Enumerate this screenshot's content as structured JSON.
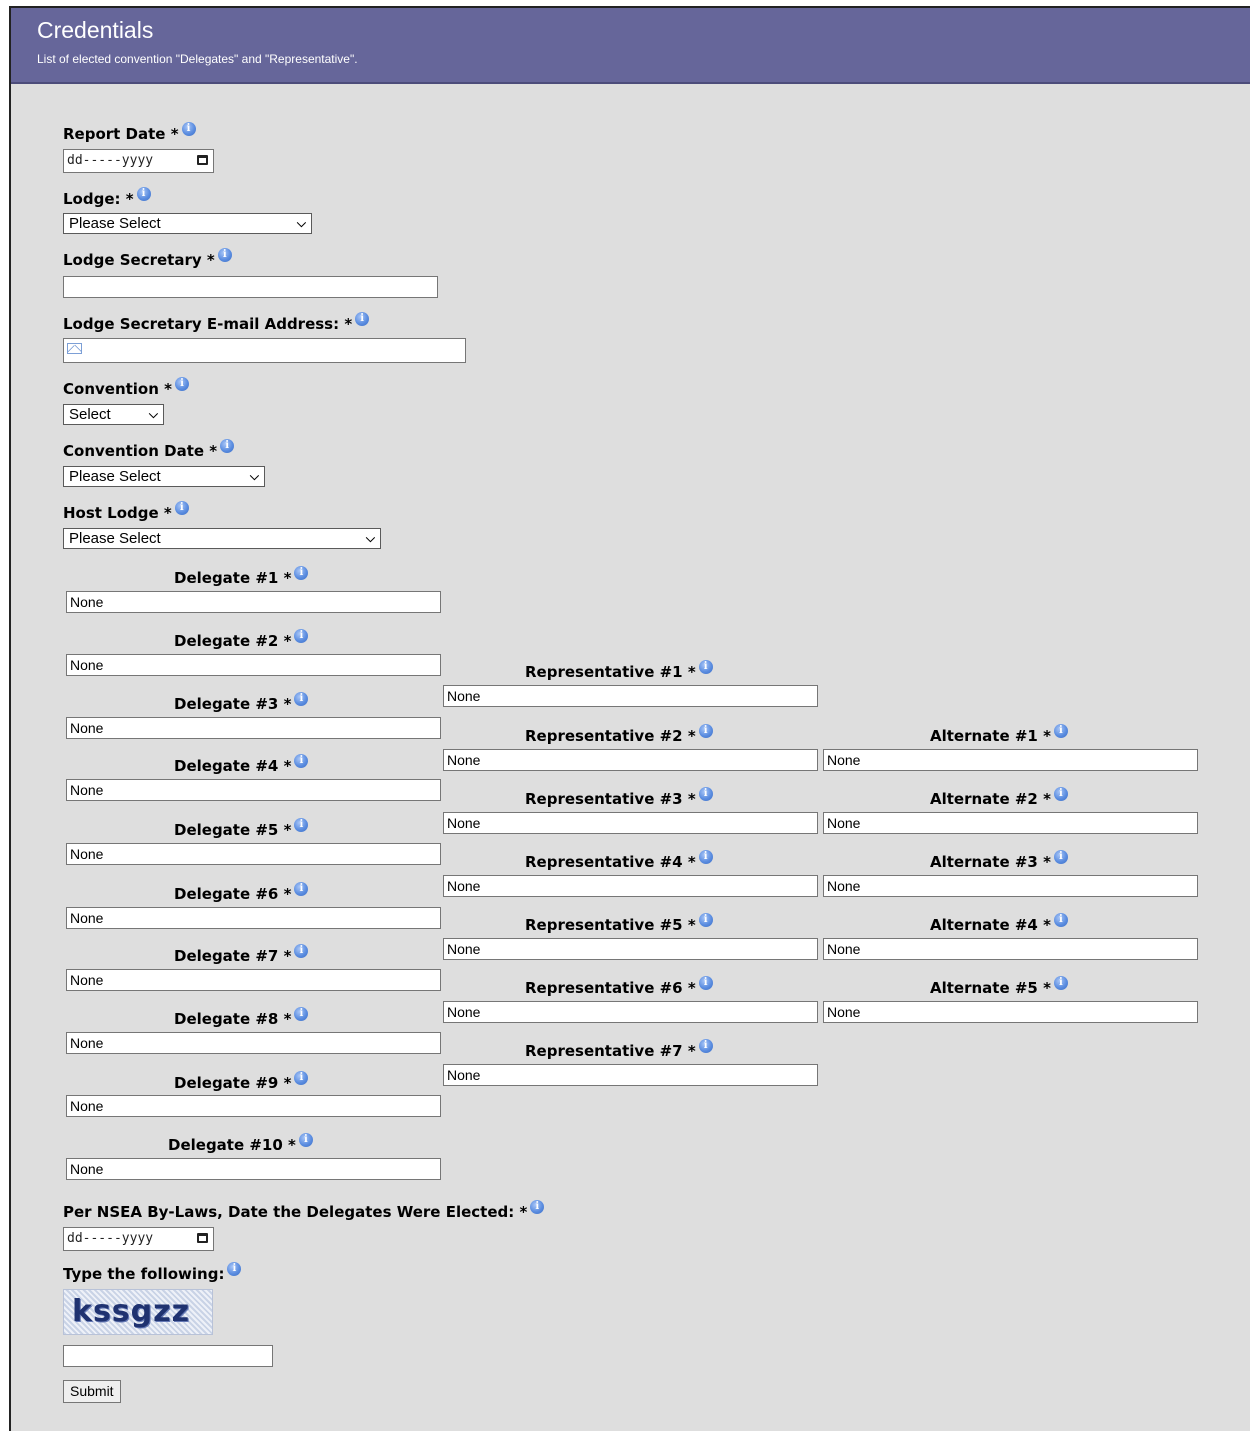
{
  "header": {
    "title": "Credentials",
    "subtitle": "List of elected convention \"Delegates\" and \"Representative\"."
  },
  "form": {
    "report_date": {
      "label": "Report Date *",
      "placeholder": "dd-----yyyy"
    },
    "lodge": {
      "label": "Lodge: *",
      "value": "Please Select"
    },
    "lodge_secretary": {
      "label": "Lodge Secretary *",
      "value": ""
    },
    "secretary_email": {
      "label": "Lodge Secretary E-mail Address: *",
      "value": ""
    },
    "convention": {
      "label": "Convention *",
      "value": "Select"
    },
    "convention_date": {
      "label": "Convention Date *",
      "value": "Please Select"
    },
    "host_lodge": {
      "label": "Host Lodge *",
      "value": "Please Select"
    },
    "delegates": [
      {
        "label": "Delegate #1 *",
        "value": "None"
      },
      {
        "label": "Delegate #2 *",
        "value": "None"
      },
      {
        "label": "Delegate #3 *",
        "value": "None"
      },
      {
        "label": "Delegate #4 *",
        "value": "None"
      },
      {
        "label": "Delegate #5 *",
        "value": "None"
      },
      {
        "label": "Delegate #6 *",
        "value": "None"
      },
      {
        "label": "Delegate #7 *",
        "value": "None"
      },
      {
        "label": "Delegate #8 *",
        "value": "None"
      },
      {
        "label": "Delegate #9 *",
        "value": "None"
      },
      {
        "label": "Delegate #10 *",
        "value": "None"
      }
    ],
    "representatives": [
      {
        "label": "Representative #1 *",
        "value": "None"
      },
      {
        "label": "Representative #2 *",
        "value": "None"
      },
      {
        "label": "Representative #3 *",
        "value": "None"
      },
      {
        "label": "Representative #4 *",
        "value": "None"
      },
      {
        "label": "Representative #5 *",
        "value": "None"
      },
      {
        "label": "Representative #6 *",
        "value": "None"
      },
      {
        "label": "Representative #7 *",
        "value": "None"
      }
    ],
    "alternates": [
      {
        "label": "Alternate #1 *",
        "value": "None"
      },
      {
        "label": "Alternate #2 *",
        "value": "None"
      },
      {
        "label": "Alternate #3 *",
        "value": "None"
      },
      {
        "label": "Alternate #4 *",
        "value": "None"
      },
      {
        "label": "Alternate #5 *",
        "value": "None"
      }
    ],
    "election_date": {
      "label": "Per NSEA By-Laws, Date the Delegates Were Elected: *",
      "placeholder": "dd-----yyyy"
    },
    "captcha": {
      "label": "Type the following:",
      "image_text": "kssgzz",
      "value": ""
    },
    "submit_label": "Submit"
  },
  "icons": {
    "info": "info-icon",
    "email": "envelope-icon",
    "calendar": "calendar-icon",
    "dropdown": "chevron-down-icon"
  }
}
